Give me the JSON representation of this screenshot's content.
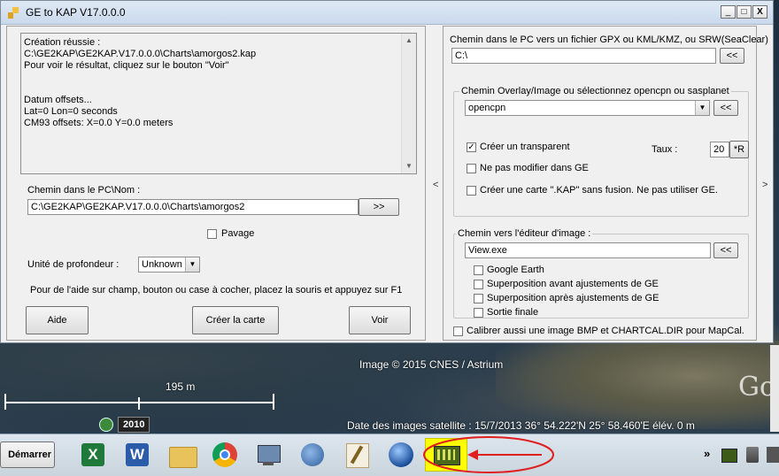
{
  "window": {
    "title": "GE to KAP V17.0.0.0",
    "min": "_",
    "max": "□",
    "close": "X"
  },
  "log": {
    "lines": [
      "Création réussie :",
      "C:\\GE2KAP\\GE2KAP.V17.0.0.0\\Charts\\amorgos2.kap",
      "Pour voir le résultat, cliquez sur le bouton \"Voir\"",
      "",
      "",
      "Datum offsets...",
      "Lat=0 Lon=0 seconds",
      "CM93 offsets: X=0.0 Y=0.0 meters"
    ]
  },
  "left": {
    "path_label": "Chemin dans le PC\\Nom :",
    "path_value": "C:\\GE2KAP\\GE2KAP.V17.0.0.0\\Charts\\amorgos2",
    "browse_label": ">>",
    "pavage_label": "Pavage",
    "depth_label": "Unité de profondeur :",
    "depth_value": "Unknown",
    "help_text": "Pour de l'aide sur champ, bouton ou case à cocher, placez la souris et appuyez sur F1",
    "aide_label": "Aide",
    "create_label": "Créer la carte",
    "voir_label": "Voir",
    "collapse_arrow": "<"
  },
  "right": {
    "gpx_label": "Chemin dans le PC vers un fichier GPX ou KML/KMZ, ou SRW(SeaClear)",
    "gpx_value": "C:\\",
    "gpx_btn": "<<",
    "overlay_title": "Chemin  Overlay/Image ou sélectionnez opencpn ou sasplanet",
    "overlay_value": "opencpn",
    "overlay_btn": "<<",
    "transparent_label": "Créer un transparent",
    "transparent_checked": "✓",
    "taux_label": "Taux :",
    "taux_value": "20",
    "taux_btn": "*R",
    "no_modify_label": "Ne pas modifier dans GE",
    "kap_label": "Créer une carte \".KAP\" sans fusion. Ne pas utiliser GE.",
    "editor_title": "Chemin vers l'éditeur d'image :",
    "editor_value": "View.exe",
    "editor_btn": "<<",
    "opt_ge": "Google Earth",
    "opt_before": "Superposition avant ajustements de GE",
    "opt_after": "Superposition après ajustements de GE",
    "opt_final": "Sortie finale",
    "calibrate_label": "Calibrer aussi une image BMP et CHARTCAL.DIR pour MapCal.",
    "expand_arrow": ">"
  },
  "ge": {
    "copyright": "Image © 2015 CNES / Astrium",
    "scale": "195  m",
    "year": "2010",
    "status": "Date des images satellite : 15/7/2013      36° 54.222'N   25° 58.460'E  élév.   0 m",
    "logo": "Go"
  },
  "taskbar": {
    "start_label": "Démarrer",
    "tray_arrow": "»"
  },
  "colors": {
    "highlight": "#ffff00",
    "annotation": "#e02020"
  }
}
